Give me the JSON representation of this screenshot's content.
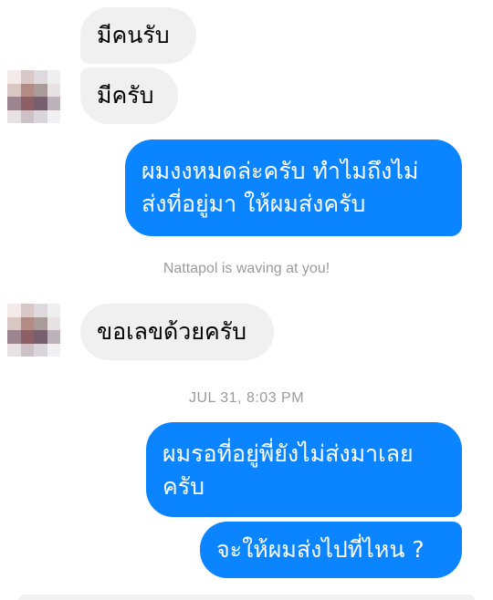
{
  "messages": {
    "incoming_1": "มีคนรับ",
    "incoming_2": "มีครับ",
    "outgoing_1_line1": "ผมงงหมดล่ะครับ ทำไมถึงไม่",
    "outgoing_1_line2": "ส่งที่อยู่มา ให้ผมส่งครับ",
    "incoming_3": "ขอเลขด้วยครับ",
    "outgoing_2_line1": "ผมรอที่อยู่พี่ยังไม่ส่งมาเลย",
    "outgoing_2_line2": "ครับ",
    "outgoing_3": "จะให้ผมส่งไปที่ไหน ?"
  },
  "system": {
    "wave_notice": "Nattapol is waving at you!",
    "timestamp": "JUL 31, 8:03 PM"
  },
  "colors": {
    "outgoing_bubble": "#0a84ff",
    "incoming_bubble": "#f0f0f0",
    "meta_text": "#9a9a9a"
  },
  "icons": {
    "avatar": "pixelated-avatar"
  }
}
